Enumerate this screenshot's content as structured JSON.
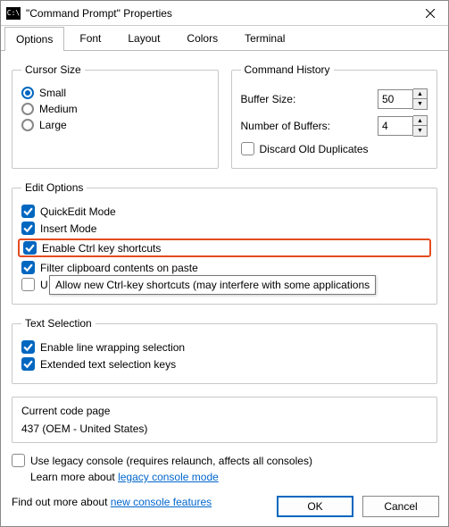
{
  "window": {
    "title": "\"Command Prompt\" Properties"
  },
  "tabs": [
    "Options",
    "Font",
    "Layout",
    "Colors",
    "Terminal"
  ],
  "cursor": {
    "legend": "Cursor Size",
    "opts": [
      "Small",
      "Medium",
      "Large"
    ]
  },
  "history": {
    "legend": "Command History",
    "buffer_label": "Buffer Size:",
    "buffer_value": "50",
    "num_label": "Number of Buffers:",
    "num_value": "4",
    "discard": "Discard Old Duplicates"
  },
  "edit": {
    "legend": "Edit Options",
    "o1": "QuickEdit Mode",
    "o2": "Insert Mode",
    "o3": "Enable Ctrl key shortcuts",
    "o4": "Filter clipboard contents on paste",
    "o5": "U"
  },
  "textsel": {
    "legend": "Text Selection",
    "o1": "Enable line wrapping selection",
    "o2": "Extended text selection keys"
  },
  "codepage": {
    "legend": "Current code page",
    "value": "437  (OEM - United States)"
  },
  "legacy": {
    "check": "Use legacy console (requires relaunch, affects all consoles)",
    "learn": "Learn more about ",
    "link": "legacy console mode"
  },
  "more": {
    "text": "Find out more about ",
    "link": "new console features"
  },
  "tooltip": "Allow new Ctrl-key shortcuts (may interfere with some applications",
  "buttons": {
    "ok": "OK",
    "cancel": "Cancel"
  }
}
